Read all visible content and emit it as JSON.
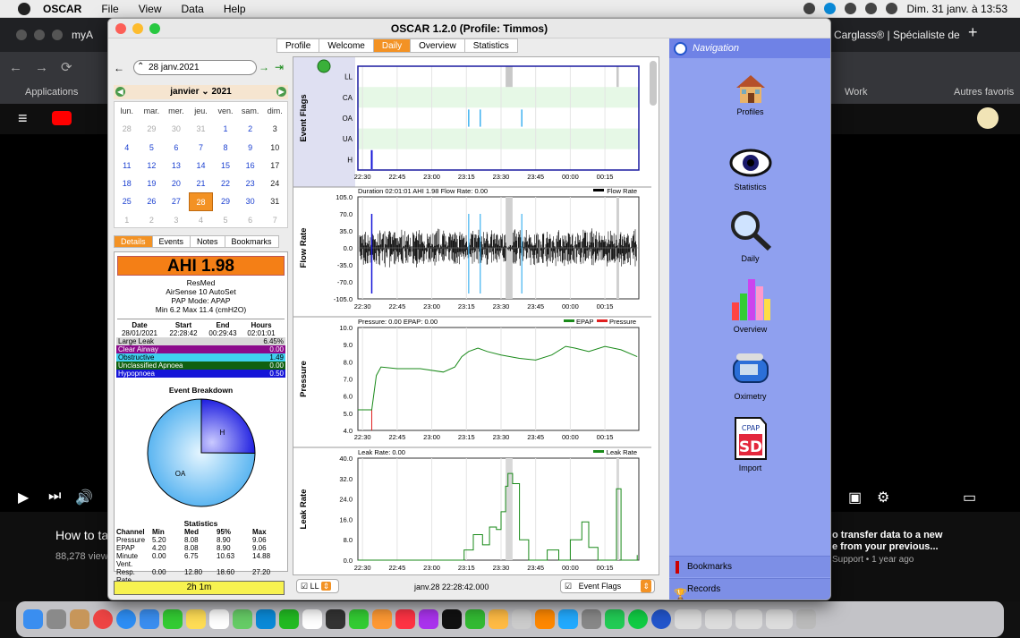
{
  "menubar": {
    "app": "OSCAR",
    "items": [
      "File",
      "View",
      "Data",
      "Help"
    ],
    "clock": "Dim. 31 janv. à  13:53"
  },
  "browser": {
    "tab_left": "myA",
    "tab_right": "Carglass® | Spécialiste de",
    "bookmarks": {
      "apps": "Applications",
      "work": "Work",
      "other": "Autres favoris"
    },
    "yt_title_left": "How to ta",
    "yt_views": "88,278 view",
    "yt_title_right": "o transfer data to a new",
    "yt_title_right2": "e from your previous...",
    "yt_meta": "Support • 1 year ago"
  },
  "window": {
    "title": "OSCAR 1.2.0 (Profile: Timmos)",
    "tabs": [
      "Profile",
      "Welcome",
      "Daily",
      "Overview",
      "Statistics"
    ],
    "active_tab": "Daily"
  },
  "calendar": {
    "date_field": "28 janv.2021",
    "month": "janvier",
    "year": "2021",
    "dow": [
      "lun.",
      "mar.",
      "mer.",
      "jeu.",
      "ven.",
      "sam.",
      "dim."
    ],
    "weeks": [
      [
        "28",
        "29",
        "30",
        "31",
        "1",
        "2",
        "3"
      ],
      [
        "4",
        "5",
        "6",
        "7",
        "8",
        "9",
        "10"
      ],
      [
        "11",
        "12",
        "13",
        "14",
        "15",
        "16",
        "17"
      ],
      [
        "18",
        "19",
        "20",
        "21",
        "22",
        "23",
        "24"
      ],
      [
        "25",
        "26",
        "27",
        "28",
        "29",
        "30",
        "31"
      ],
      [
        "1",
        "2",
        "3",
        "4",
        "5",
        "6",
        "7"
      ]
    ],
    "selected": "28"
  },
  "subtabs": [
    "Details",
    "Events",
    "Notes",
    "Bookmarks"
  ],
  "details": {
    "ahi": "AHI 1.98",
    "machine": [
      "ResMed",
      "AirSense 10 AutoSet",
      "PAP Mode: APAP",
      "Min 6.2 Max 11.4 (cmH2O)"
    ],
    "session_headers": [
      "Date",
      "Start",
      "End",
      "Hours"
    ],
    "session_values": [
      "28/01/2021",
      "22:28:42",
      "00:29:43",
      "02:01:01"
    ],
    "events": [
      {
        "label": "Large Leak",
        "value": "6.45%",
        "bg": "#d8d8d8",
        "fg": "#000"
      },
      {
        "label": "Clear Airway",
        "value": "0.00",
        "bg": "#8b0a8b",
        "fg": "#fff"
      },
      {
        "label": "Obstructive",
        "value": "1.49",
        "bg": "#3fd0f0",
        "fg": "#000"
      },
      {
        "label": "Unclassified Apnoea",
        "value": "0.00",
        "bg": "#106010",
        "fg": "#fff"
      },
      {
        "label": "Hypopnoea",
        "value": "0.50",
        "bg": "#1515d8",
        "fg": "#fff"
      }
    ],
    "breakdown_title": "Event Breakdown",
    "pie": [
      {
        "label": "H",
        "value": 0.5,
        "color": "#3f3fe8"
      },
      {
        "label": "OA",
        "value": 1.49,
        "color": "#3fb2f0"
      }
    ],
    "stats_title": "Statistics",
    "stats_headers": [
      "Channel",
      "Min",
      "Med",
      "95%",
      "Max"
    ],
    "stats_rows": [
      [
        "Pressure",
        "5.20",
        "8.08",
        "8.90",
        "9.06"
      ],
      [
        "EPAP",
        "4.20",
        "8.08",
        "8.90",
        "9.06"
      ],
      [
        "Minute Vent.",
        "0.00",
        "6.75",
        "10.63",
        "14.88"
      ],
      [
        "Resp. Rate",
        "0.00",
        "12.80",
        "18.60",
        "27.20"
      ]
    ],
    "duration": "2h 1m"
  },
  "chart_data": [
    {
      "type": "line",
      "ylabel": "Event Flags",
      "categories": [
        "LL",
        "CA",
        "OA",
        "UA",
        "H"
      ],
      "x_ticks": [
        "22:30",
        "22:45",
        "23:00",
        "23:15",
        "23:30",
        "23:45",
        "00:00",
        "00:15"
      ],
      "events": {
        "OA": [
          "23:16",
          "23:21",
          "23:39"
        ],
        "H": [
          "22:34"
        ],
        "LL": [
          [
            "23:32",
            "23:35"
          ],
          [
            "00:20",
            "00:21"
          ]
        ]
      }
    },
    {
      "type": "line",
      "ylabel": "Flow Rate",
      "title": "Duration 02:01:01 AHI 1.98 Flow Rate: 0.00",
      "legend": [
        "Flow Rate"
      ],
      "ylim": [
        -105,
        105
      ],
      "y_ticks": [
        "105.0",
        "70.0",
        "35.0",
        "0.0",
        "-35.0",
        "-70.0",
        "-105.0"
      ],
      "x_ticks": [
        "22:30",
        "22:45",
        "23:00",
        "23:15",
        "23:30",
        "23:45",
        "00:00",
        "00:15"
      ]
    },
    {
      "type": "line",
      "ylabel": "Pressure",
      "title": "Pressure: 0.00 EPAP: 0.00",
      "legend": [
        {
          "name": "EPAP",
          "color": "#1a8a1a"
        },
        {
          "name": "Pressure",
          "color": "#e02020"
        }
      ],
      "ylim": [
        4,
        10
      ],
      "y_ticks": [
        "10.0",
        "9.0",
        "8.0",
        "7.0",
        "6.0",
        "5.0",
        "4.0"
      ],
      "x_ticks": [
        "22:30",
        "22:45",
        "23:00",
        "23:15",
        "23:30",
        "23:45",
        "00:00",
        "00:15"
      ],
      "x": [
        "22:28",
        "22:32",
        "22:34",
        "22:36",
        "22:38",
        "22:45",
        "22:55",
        "23:05",
        "23:10",
        "23:13",
        "23:16",
        "23:20",
        "23:24",
        "23:30",
        "23:38",
        "23:45",
        "23:52",
        "23:58",
        "00:02",
        "00:08",
        "00:15",
        "00:22",
        "00:29"
      ],
      "epap": [
        5.2,
        5.2,
        5.2,
        7.2,
        7.7,
        7.6,
        7.6,
        7.4,
        7.7,
        8.3,
        8.6,
        8.8,
        8.6,
        8.4,
        8.2,
        8.1,
        8.4,
        8.9,
        8.8,
        8.6,
        8.9,
        8.7,
        8.3
      ]
    },
    {
      "type": "line",
      "ylabel": "Leak Rate",
      "title": "Leak Rate: 0.00",
      "legend": [
        "Leak Rate"
      ],
      "ylim": [
        0,
        40
      ],
      "y_ticks": [
        "40.0",
        "32.0",
        "24.0",
        "16.0",
        "8.0",
        "0.0"
      ],
      "x_ticks": [
        "22:30",
        "22:45",
        "23:00",
        "23:15",
        "23:30",
        "23:45",
        "00:00",
        "00:15"
      ],
      "x": [
        "22:28",
        "23:10",
        "23:14",
        "23:18",
        "23:22",
        "23:25",
        "23:28",
        "23:30",
        "23:32",
        "23:33",
        "23:35",
        "23:38",
        "23:42",
        "23:50",
        "23:55",
        "00:00",
        "00:05",
        "00:08",
        "00:12",
        "00:15",
        "00:18",
        "00:20",
        "00:22",
        "00:29"
      ],
      "values": [
        0,
        0,
        4,
        10,
        6,
        13,
        12,
        19,
        29,
        34,
        30,
        8,
        0,
        4,
        0,
        8,
        15,
        5,
        0,
        0,
        0,
        28,
        0,
        2
      ]
    }
  ],
  "bottom": {
    "left_select": "LL",
    "timestamp": "janv.28 22:28:42.000",
    "right_select": "Event Flags"
  },
  "navigation": {
    "title": "Navigation",
    "items": [
      "Profiles",
      "Statistics",
      "Daily",
      "Overview",
      "Oximetry",
      "Import"
    ],
    "footer": [
      "Bookmarks",
      "Records"
    ]
  },
  "colors": {
    "accent": "#f39224",
    "nav_bg": "#8fa0ef",
    "ahi_bg": "#f47f16",
    "duration_bg": "#f7f250"
  }
}
